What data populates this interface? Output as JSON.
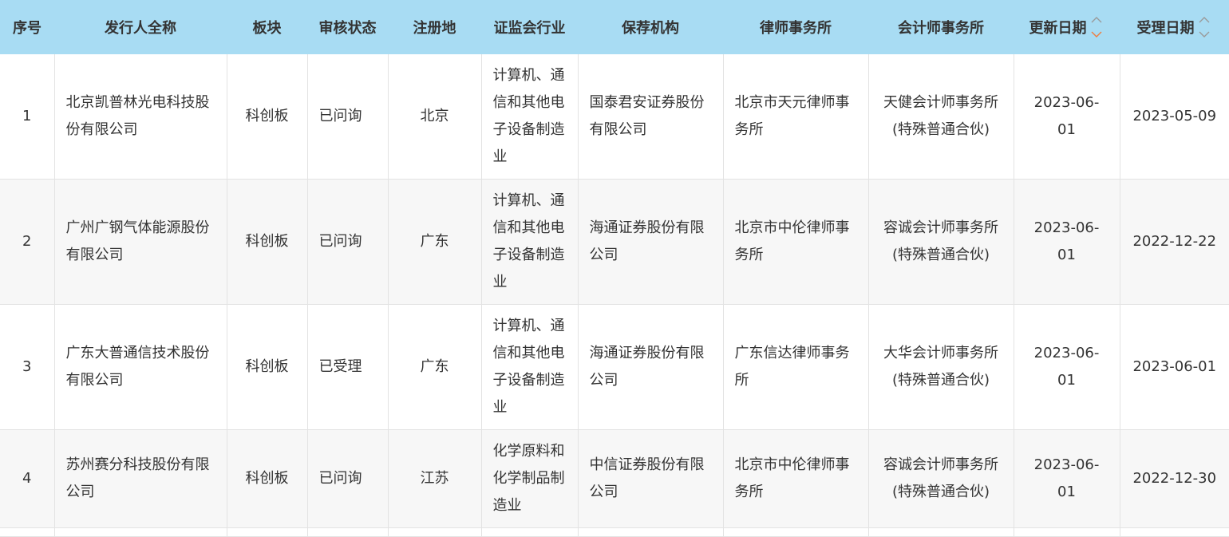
{
  "colors": {
    "header_bg": "#a8dcf3",
    "row_alt_bg": "#f7f7f7",
    "border": "#e3e3e3",
    "sort_inactive": "#9a9a9a",
    "sort_active": "#f07c3e"
  },
  "table": {
    "headers": {
      "index": "序号",
      "issuer": "发行人全称",
      "board": "板块",
      "status": "审核状态",
      "region": "注册地",
      "industry": "证监会行业",
      "sponsor": "保荐机构",
      "law_firm": "律师事务所",
      "accounting_firm": "会计师事务所",
      "update_date": "更新日期",
      "accept_date": "受理日期"
    },
    "sort_icons": {
      "update_date_up": "chevron-up-icon",
      "update_date_down": "chevron-down-icon-active",
      "accept_date_up": "chevron-up-icon",
      "accept_date_down": "chevron-down-icon"
    },
    "rows": [
      {
        "index": "1",
        "issuer": "北京凯普林光电科技股份有限公司",
        "board": "科创板",
        "status": "已问询",
        "region": "北京",
        "industry": "计算机、通信和其他电子设备制造业",
        "sponsor": "国泰君安证券股份有限公司",
        "law_firm": "北京市天元律师事务所",
        "accounting_firm": "天健会计师事务所(特殊普通合伙)",
        "update_date": "2023-06-01",
        "accept_date": "2023-05-09"
      },
      {
        "index": "2",
        "issuer": "广州广钢气体能源股份有限公司",
        "board": "科创板",
        "status": "已问询",
        "region": "广东",
        "industry": "计算机、通信和其他电子设备制造业",
        "sponsor": "海通证券股份有限公司",
        "law_firm": "北京市中伦律师事务所",
        "accounting_firm": "容诚会计师事务所(特殊普通合伙)",
        "update_date": "2023-06-01",
        "accept_date": "2022-12-22"
      },
      {
        "index": "3",
        "issuer": "广东大普通信技术股份有限公司",
        "board": "科创板",
        "status": "已受理",
        "region": "广东",
        "industry": "计算机、通信和其他电子设备制造业",
        "sponsor": "海通证券股份有限公司",
        "law_firm": "广东信达律师事务所",
        "accounting_firm": "大华会计师事务所(特殊普通合伙)",
        "update_date": "2023-06-01",
        "accept_date": "2023-06-01"
      },
      {
        "index": "4",
        "issuer": "苏州赛分科技股份有限公司",
        "board": "科创板",
        "status": "已问询",
        "region": "江苏",
        "industry": "化学原料和化学制品制造业",
        "sponsor": "中信证券股份有限公司",
        "law_firm": "北京市中伦律师事务所",
        "accounting_firm": "容诚会计师事务所(特殊普通合伙)",
        "update_date": "2023-06-01",
        "accept_date": "2022-12-30"
      }
    ]
  }
}
